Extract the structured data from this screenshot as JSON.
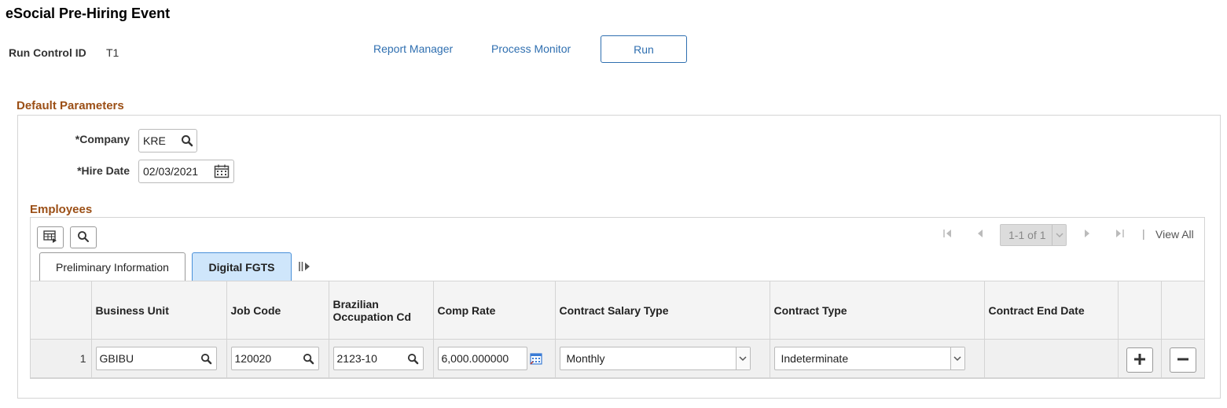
{
  "page": {
    "title": "eSocial Pre-Hiring Event",
    "run_control_label": "Run Control ID",
    "run_control_value": "T1"
  },
  "header_links": {
    "report_manager": "Report Manager",
    "process_monitor": "Process Monitor",
    "run": "Run"
  },
  "default_parameters": {
    "title": "Default Parameters",
    "company_label": "*Company",
    "company_value": "KRE",
    "hire_date_label": "*Hire Date",
    "hire_date_value": "02/03/2021"
  },
  "employees": {
    "title": "Employees",
    "pager": {
      "range": "1-1 of 1",
      "view_all": "View All"
    },
    "tabs": [
      {
        "label": "Preliminary Information",
        "active": false
      },
      {
        "label": "Digital FGTS",
        "active": true
      }
    ],
    "columns": {
      "business_unit": "Business Unit",
      "job_code": "Job Code",
      "occupation_line1": "Brazilian",
      "occupation_line2": "Occupation Cd",
      "comp_rate": "Comp Rate",
      "contract_salary_type": "Contract Salary Type",
      "contract_type": "Contract Type",
      "contract_end_date": "Contract End Date"
    },
    "rows": [
      {
        "num": "1",
        "business_unit": "GBIBU",
        "job_code": "120020",
        "occupation_cd": "2123-10",
        "comp_rate": "6,000.000000",
        "contract_salary_type": "Monthly",
        "contract_type": "Indeterminate",
        "contract_end_date": ""
      }
    ]
  },
  "colors": {
    "link": "#2f6fb0",
    "section_title": "#9b4f16",
    "active_tab": "#cfe6fb"
  }
}
